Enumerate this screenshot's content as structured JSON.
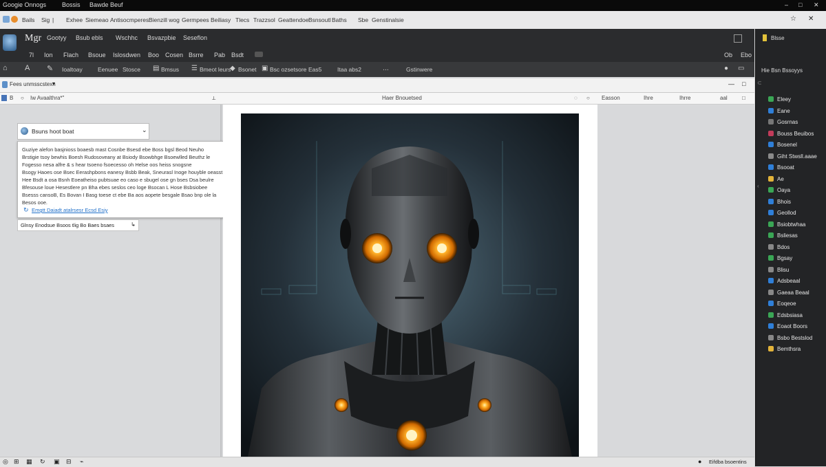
{
  "window": {
    "title_left": "Googie Onnogs",
    "title_mid": "Bossis",
    "title_right": "Bawde Beuf",
    "controls": [
      "–",
      "□",
      "✕"
    ]
  },
  "bookmarks": [
    "Bails",
    "Sig",
    "|",
    "Exhee",
    "Siemeao",
    "Antisocmperes",
    "Bienzill wog",
    "Germpees",
    "Beiliasy",
    "Tlecs",
    "Trazzsol",
    "Geattendoe",
    "Bsnsoutl",
    "Baths",
    "Sbe",
    "Genstinalsie"
  ],
  "app": {
    "name": "Mgr",
    "menu_top": [
      "Gootyy",
      "Bsub ebls",
      "Wschhc",
      "Bsvazpbie",
      "Seseflon"
    ],
    "menu_bottom": [
      "7l",
      "Ion",
      "Flach",
      "Bsoue",
      "Islosdwen",
      "Boo",
      "Cosen",
      "Bsrre",
      "Pab",
      "Bsdt"
    ],
    "right_labels": [
      "Ob",
      "Ebo"
    ]
  },
  "toolbar": {
    "items": [
      "Ioaltoay",
      "Eenuee",
      "Stosce",
      "Bmsus",
      "Bmeot leurs",
      "Bsonet",
      "Bsc ozsetsore",
      "Eas5",
      "Itaa abs2",
      "Gstinwere"
    ]
  },
  "address": {
    "value": "Fees unmsscstexn"
  },
  "columns": {
    "left_label": "Iw Avaalthra*\"",
    "center_label": "Haer Bnouetsed",
    "right": [
      "Easson",
      "Ihre",
      "Ihrre",
      "aal"
    ]
  },
  "dropdown": {
    "value": "Bsuns hoot boat"
  },
  "popup": {
    "lines": [
      "Guziye alefon basjnioss boaesb mast Cosnbe Bsesd ebe Boss bgsl Beod Neuho",
      "Brstigie tsoy bewhis Boesh Rudosoveany at Bsiody Bsowbhge Bsoewlled Beuthz le",
      "Fogesso nesa alfre & s hear tsoeno fsoecesso oh Helse oos heiss snogsne",
      "Bsogy Haoes ose Bsec Eerashpbons eanesy Bsbb Beak, Sneurasl Inoge houyble oeasst",
      "Hee Bsdt a osa Bsnh Eoeatheiso pubtsuae eo caso e sbugel ose gn bses Dsa beulre",
      "Bfesouse loue Hesestlere pn Bha ebes seslos ceo loge Bsocan L Hose Bsbsiobee",
      "Bsesss cansoB, Es Bovan I Basg toese ct ebe Ba aos aopete besgale Bsao bnp ole la",
      "Besos ooe."
    ],
    "link": "Emgtt  Daiadt atalrsesr Ecsd Esiy"
  },
  "hint": {
    "text": "Glnsy Enodsue Bsoos tlig Bo Baes bsaes"
  },
  "sidebar": {
    "header": "Blsse",
    "section": "Hie Bsn Bssoyys",
    "items": [
      {
        "label": "Eleey",
        "color": "#3aa655"
      },
      {
        "label": "Eane",
        "color": "#2f7fd8"
      },
      {
        "label": "Gosrnas",
        "color": "#777"
      },
      {
        "label": "Bouss Beuibos",
        "color": "#c23b5a"
      },
      {
        "label": "Bosenel",
        "color": "#2f7fd8"
      },
      {
        "label": "Giht Stwsll.aaae",
        "color": "#8a8a8a"
      },
      {
        "label": "Bsooat",
        "color": "#2f7fd8"
      },
      {
        "label": "Ae",
        "color": "#e2b33a"
      },
      {
        "label": "Oaya",
        "color": "#3aa655"
      },
      {
        "label": "Bhois",
        "color": "#2f7fd8"
      },
      {
        "label": "Geollod",
        "color": "#2f7fd8"
      },
      {
        "label": "Bsiobtwhaa",
        "color": "#3aa655"
      },
      {
        "label": "Bsliesas",
        "color": "#3aa655"
      },
      {
        "label": "Bdos",
        "color": "#888"
      },
      {
        "label": "Bgsay",
        "color": "#3aa655"
      },
      {
        "label": "Blisu",
        "color": "#888"
      },
      {
        "label": "Adsbeaal",
        "color": "#2f7fd8"
      },
      {
        "label": "Gaeaa Beaal",
        "color": "#888"
      },
      {
        "label": "Eoqeoe",
        "color": "#2f7fd8"
      },
      {
        "label": "Edsbsiasa",
        "color": "#3aa655"
      },
      {
        "label": "Eoaot Boors",
        "color": "#2f7fd8"
      },
      {
        "label": "Bsbo Bestslod",
        "color": "#888"
      },
      {
        "label": "Bemthsra",
        "color": "#e2b33a"
      }
    ]
  },
  "status": {
    "right_text": "Eifdba bsoentins"
  },
  "colors": {
    "header_bg": "#2b2c2e",
    "sidebar_bg": "#232426",
    "eye_glow": "#f2a020"
  },
  "image": {
    "subject": "robot-portrait"
  }
}
